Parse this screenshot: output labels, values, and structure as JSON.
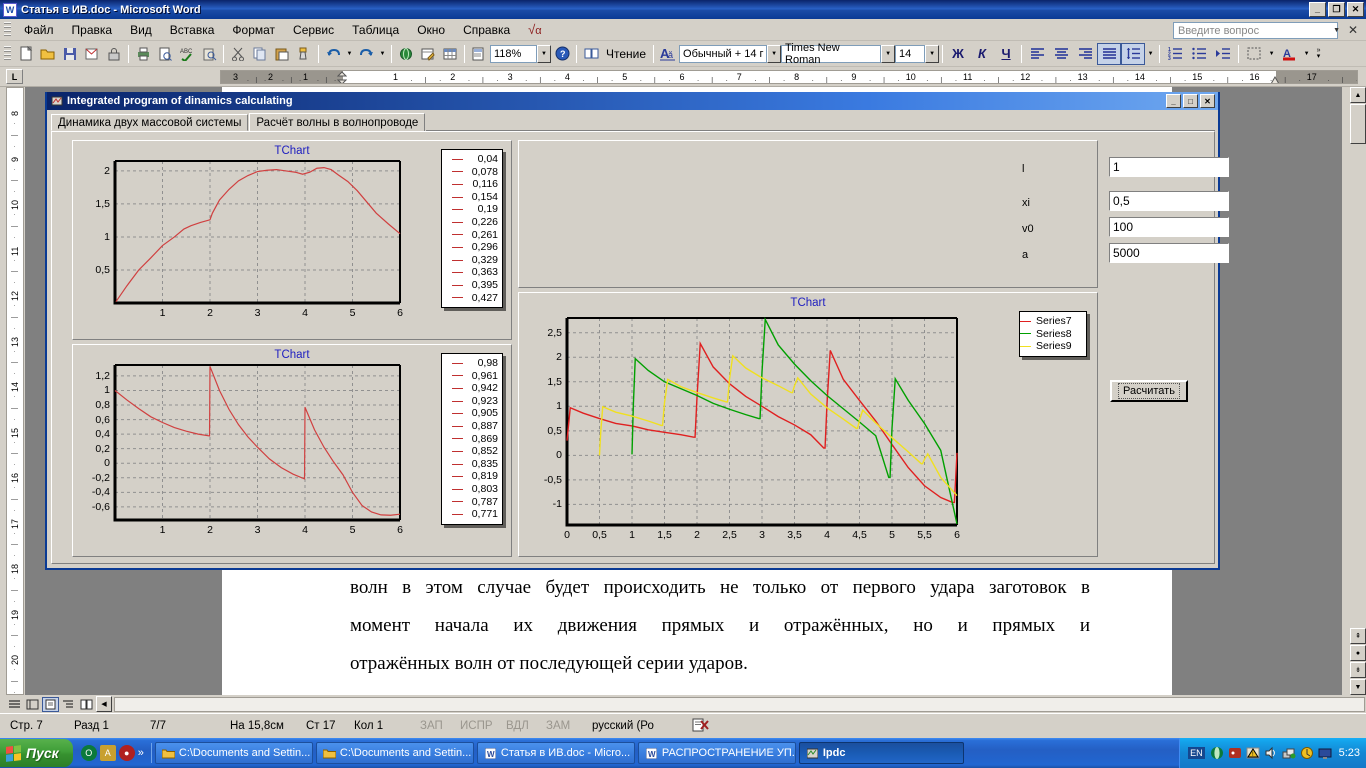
{
  "word": {
    "title": "Статья в ИВ.doc - Microsoft Word",
    "icon": "word-document-icon",
    "menu": [
      "Файл",
      "Правка",
      "Вид",
      "Вставка",
      "Формат",
      "Сервис",
      "Таблица",
      "Окно",
      "Справка"
    ],
    "menu_formula_icon": "square-root-alpha-icon",
    "ask_placeholder": "Введите вопрос",
    "window_buttons": {
      "minimize": "_",
      "restore": "❐",
      "close": "✕"
    },
    "toolbar": {
      "zoom_value": "118%",
      "reading_label": "Чтение",
      "style_value": "Обычный + 14 г",
      "font_value": "Times New Roman",
      "size_value": "14",
      "bold": "Ж",
      "italic": "К",
      "underline": "Ч"
    },
    "ruler": {
      "horizontal_marks": [
        "3",
        "2",
        "1",
        "1",
        "2",
        "3",
        "4",
        "5",
        "6",
        "7",
        "8",
        "9",
        "10",
        "11",
        "12",
        "13",
        "14",
        "15",
        "16",
        "17"
      ],
      "vertical_marks": [
        "8",
        "9",
        "10",
        "11",
        "12",
        "13",
        "14",
        "15",
        "16",
        "17",
        "18",
        "19",
        "20"
      ]
    },
    "document_paragraphs": [
      "волн в этом случае будет происходить не только от первого удара заготовок в",
      "момент начала их движения прямых и отражённых, но и прямых и",
      "отражённых волн от последующей серии ударов."
    ],
    "status": {
      "page": "Стр. 7",
      "section": "Разд 1",
      "pages": "7/7",
      "at": "На 15,8см",
      "line": "Ст 17",
      "col": "Кол 1",
      "rec": "ЗАП",
      "trk": "ИСПР",
      "ext": "ВДЛ",
      "ovr": "ЗАМ",
      "language": "русский (Ро",
      "spell_icon": "spellcheck-status-icon"
    },
    "view_buttons": [
      "normal-view",
      "web-layout-view",
      "print-layout-view",
      "outline-view",
      "reading-view"
    ]
  },
  "ipdc": {
    "title": "Integrated program of dinamics calculating",
    "title_icon": "app-icon",
    "window_buttons": {
      "minimize": "_",
      "maximize": "□",
      "close": "✕"
    },
    "tabs": [
      {
        "label": "Динамика двух массовой системы",
        "active": false
      },
      {
        "label": "Расчёт волны в волнопроводе",
        "active": true
      }
    ],
    "fields": [
      {
        "label": "l",
        "value": "1"
      },
      {
        "label": "xi",
        "value": "0,5"
      },
      {
        "label": "v0",
        "value": "100"
      },
      {
        "label": "a",
        "value": "5000"
      }
    ],
    "calc_button": "Расчитать",
    "colors": {
      "series7": "#e02020",
      "series8": "#00a000",
      "series9": "#f0e020",
      "chart_line": "#d04040",
      "chart_title": "#2020c0",
      "panel_bg": "#d4d0c8",
      "titlebar": "#0a246a"
    }
  },
  "chart_data": [
    {
      "id": "chart1",
      "type": "line",
      "title": "TChart",
      "xlabel": "",
      "ylabel": "",
      "xlim": [
        0,
        6
      ],
      "ylim": [
        0,
        2.15
      ],
      "xticks": [
        "1",
        "2",
        "3",
        "4",
        "5",
        "6"
      ],
      "yticks": [
        "0,5",
        "1",
        "1,5",
        "2"
      ],
      "grid": true,
      "legend_position": "right",
      "legend": [
        "0,04",
        "0,078",
        "0,116",
        "0,154",
        "0,19",
        "0,226",
        "0,261",
        "0,296",
        "0,329",
        "0,363",
        "0,395",
        "0,427"
      ],
      "series": [
        {
          "name": "0,04",
          "color": "#d04040",
          "x": [
            0.02,
            0.25,
            0.5,
            0.75,
            1.0,
            1.25,
            1.45,
            1.6,
            1.8,
            2.0,
            2.05,
            2.2,
            2.4,
            2.6,
            2.8,
            3.0,
            3.2,
            3.4,
            3.6,
            3.8,
            3.95,
            4.1,
            4.25,
            4.4,
            4.55,
            4.7,
            4.9,
            5.1,
            5.3,
            5.5,
            5.75,
            6.0
          ],
          "y": [
            0.02,
            0.26,
            0.5,
            0.68,
            0.87,
            1.0,
            1.12,
            1.17,
            1.22,
            1.26,
            1.36,
            1.56,
            1.72,
            1.85,
            1.93,
            1.99,
            2.01,
            2.02,
            2.0,
            1.98,
            1.95,
            1.98,
            2.04,
            2.05,
            2.02,
            1.94,
            1.84,
            1.7,
            1.53,
            1.36,
            1.2,
            1.05
          ]
        }
      ]
    },
    {
      "id": "chart2",
      "type": "line",
      "title": "TChart",
      "xlabel": "",
      "ylabel": "",
      "xlim": [
        0,
        6
      ],
      "ylim": [
        -0.78,
        1.35
      ],
      "xticks": [
        "1",
        "2",
        "3",
        "4",
        "5",
        "6"
      ],
      "yticks": [
        "1,2",
        "1",
        "0,8",
        "0,6",
        "0,4",
        "0,2",
        "0",
        "-0,2",
        "-0,4",
        "-0,6"
      ],
      "grid": true,
      "legend_position": "right",
      "legend": [
        "0,98",
        "0,961",
        "0,942",
        "0,923",
        "0,905",
        "0,887",
        "0,869",
        "0,852",
        "0,835",
        "0,819",
        "0,803",
        "0,787",
        "0,771"
      ],
      "series": [
        {
          "name": "0,98",
          "color": "#d04040",
          "x": [
            0.0,
            0.25,
            0.5,
            0.75,
            1.0,
            1.25,
            1.5,
            1.75,
            1.99,
            2.0,
            2.0,
            2.2,
            2.4,
            2.6,
            2.8,
            3.0,
            3.25,
            3.5,
            3.75,
            3.99,
            4.0,
            4.0,
            4.2,
            4.4,
            4.6,
            4.8,
            5.0,
            5.2,
            5.4,
            5.6,
            5.8,
            6.0
          ],
          "y": [
            1.0,
            0.87,
            0.75,
            0.64,
            0.56,
            0.49,
            0.44,
            0.4,
            0.375,
            1.33,
            1.33,
            1.0,
            0.74,
            0.53,
            0.36,
            0.22,
            0.06,
            -0.06,
            -0.15,
            -0.215,
            0.77,
            0.77,
            0.46,
            0.22,
            0.02,
            -0.16,
            -0.4,
            -0.58,
            -0.67,
            -0.71,
            -0.715,
            -0.7
          ]
        }
      ]
    },
    {
      "id": "chart3",
      "type": "line",
      "title": "TChart",
      "xlabel": "",
      "ylabel": "",
      "xlim": [
        0,
        6
      ],
      "ylim": [
        -1.42,
        2.8
      ],
      "xticks": [
        "0",
        "0,5",
        "1",
        "1,5",
        "2",
        "2,5",
        "3",
        "3,5",
        "4",
        "4,5",
        "5",
        "5,5",
        "6"
      ],
      "yticks": [
        "2,5",
        "2",
        "1,5",
        "1",
        "0,5",
        "0",
        "-0,5",
        "-1"
      ],
      "grid": true,
      "legend_position": "right",
      "legend": [
        "Series7",
        "Series8",
        "Series9"
      ],
      "series": [
        {
          "name": "Series7",
          "color": "#e02020",
          "x": [
            0.0,
            0.05,
            0.25,
            0.5,
            0.75,
            1.0,
            1.25,
            1.5,
            1.75,
            1.95,
            1.97,
            2.0,
            2.05,
            2.25,
            2.5,
            2.75,
            3.0,
            3.25,
            3.5,
            3.75,
            3.95,
            3.97,
            4.0,
            4.05,
            4.25,
            4.5,
            4.75,
            5.0,
            5.25,
            5.5,
            5.75,
            5.93,
            5.96,
            6.0
          ],
          "y": [
            0.3,
            0.97,
            0.86,
            0.75,
            0.65,
            0.6,
            0.52,
            0.47,
            0.42,
            0.37,
            0.37,
            1.18,
            2.28,
            1.8,
            1.46,
            1.2,
            1.0,
            0.79,
            0.62,
            0.42,
            0.15,
            0.15,
            1.05,
            2.14,
            1.55,
            1.12,
            0.7,
            0.22,
            -0.25,
            -0.62,
            -0.86,
            -0.96,
            -0.96,
            0.05
          ]
        },
        {
          "name": "Series8",
          "color": "#00a000",
          "x": [
            1.0,
            1.02,
            1.05,
            1.25,
            1.5,
            1.75,
            2.0,
            2.25,
            2.5,
            2.75,
            2.95,
            2.97,
            3.0,
            3.05,
            3.25,
            3.5,
            3.75,
            4.0,
            4.25,
            4.5,
            4.75,
            4.95,
            4.97,
            5.0,
            5.05,
            5.25,
            5.5,
            5.75,
            6.0
          ],
          "y": [
            0.02,
            1.0,
            1.97,
            1.73,
            1.5,
            1.36,
            1.22,
            1.06,
            0.94,
            0.83,
            0.75,
            0.75,
            1.7,
            2.77,
            2.25,
            1.86,
            1.52,
            1.22,
            0.95,
            0.68,
            0.4,
            -0.45,
            -0.45,
            0.55,
            1.56,
            1.12,
            0.65,
            0.1,
            -1.4
          ]
        },
        {
          "name": "Series9",
          "color": "#f0e020",
          "x": [
            0.5,
            0.52,
            0.55,
            0.75,
            1.0,
            1.25,
            1.45,
            1.47,
            1.5,
            1.55,
            1.75,
            2.0,
            2.25,
            2.45,
            2.47,
            2.5,
            2.55,
            2.75,
            3.0,
            3.25,
            3.45,
            3.47,
            3.5,
            3.55,
            3.75,
            4.0,
            4.25,
            4.45,
            4.47,
            4.5,
            4.55,
            4.75,
            5.0,
            5.25,
            5.45,
            5.47,
            5.5,
            5.55,
            5.75,
            6.0
          ],
          "y": [
            0.0,
            0.5,
            0.99,
            0.88,
            0.8,
            0.7,
            0.61,
            0.61,
            1.07,
            1.55,
            1.4,
            1.28,
            1.17,
            1.09,
            1.09,
            1.55,
            2.03,
            1.78,
            1.58,
            1.42,
            1.28,
            1.28,
            1.42,
            1.58,
            1.25,
            0.97,
            0.74,
            0.55,
            0.55,
            0.72,
            0.92,
            0.66,
            0.36,
            0.07,
            -0.17,
            -0.17,
            -0.08,
            0.03,
            -0.45,
            -0.82
          ]
        }
      ]
    }
  ],
  "taskbar": {
    "start": "Пуск",
    "quicklaunch": [
      "opera-icon",
      "pdf-icon",
      "media-icon",
      "chevron-more-icon"
    ],
    "tasks": [
      {
        "label": "C:\\Documents and Settin...",
        "icon": "folder-icon",
        "active": false
      },
      {
        "label": "C:\\Documents and Settin...",
        "icon": "folder-icon",
        "active": false
      },
      {
        "label": "Статья в ИВ.doc - Micro...",
        "icon": "word-icon",
        "active": false
      },
      {
        "label": "РАСПРОСТРАНЕНИЕ УП...",
        "icon": "word-icon",
        "active": false
      },
      {
        "label": "Ipdc",
        "icon": "app-icon",
        "active": true
      }
    ],
    "tray": {
      "language": "EN",
      "icons": [
        "opera-tray-icon",
        "antivirus-icon",
        "warning-icon",
        "volume-icon",
        "network-icon",
        "update-icon",
        "monitor-icon"
      ],
      "time": "5:23"
    }
  }
}
